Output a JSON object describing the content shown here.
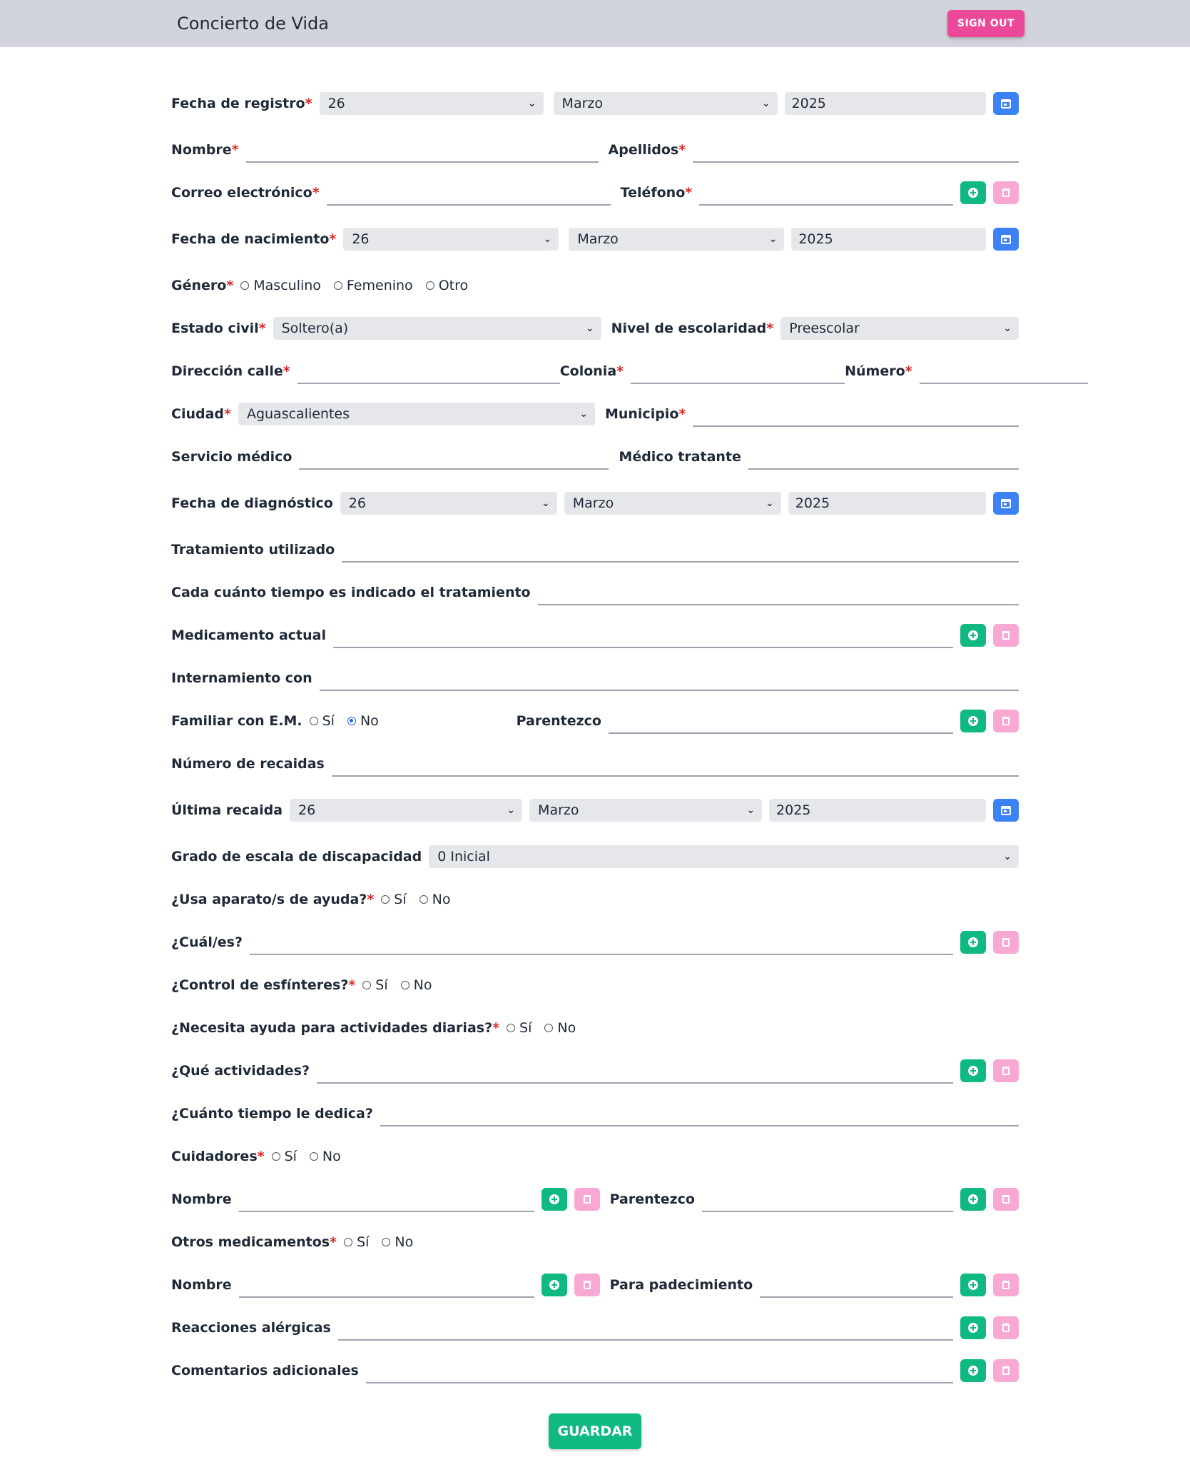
{
  "header": {
    "title": "Concierto de Vida",
    "sign_out": "SIGN OUT"
  },
  "req": "*",
  "fecha_registro": {
    "label": "Fecha de registro",
    "day": "26",
    "month": "Marzo",
    "year": "2025"
  },
  "nombre": {
    "label": "Nombre"
  },
  "apellidos": {
    "label": "Apellidos"
  },
  "correo": {
    "label": "Correo electrónico"
  },
  "telefono": {
    "label": "Teléfono"
  },
  "fecha_nacimiento": {
    "label": "Fecha de nacimiento",
    "day": "26",
    "month": "Marzo",
    "year": "2025"
  },
  "genero": {
    "label": "Género",
    "options": [
      "Masculino",
      "Femenino",
      "Otro"
    ]
  },
  "estado_civil": {
    "label": "Estado civil",
    "value": "Soltero(a)"
  },
  "escolaridad": {
    "label": "Nivel de escolaridad",
    "value": "Preescolar"
  },
  "direccion": {
    "label": "Dirección calle"
  },
  "colonia": {
    "label": "Colonia"
  },
  "numero": {
    "label": "Número"
  },
  "ciudad": {
    "label": "Ciudad",
    "value": "Aguascalientes"
  },
  "municipio": {
    "label": "Municipio"
  },
  "servicio_medico": {
    "label": "Servicio médico"
  },
  "medico_tratante": {
    "label": "Médico tratante"
  },
  "fecha_diagnostico": {
    "label": "Fecha de diagnóstico",
    "day": "26",
    "month": "Marzo",
    "year": "2025"
  },
  "tratamiento": {
    "label": "Tratamiento utilizado"
  },
  "frecuencia": {
    "label": "Cada cuánto tiempo es indicado el tratamiento"
  },
  "medicamento_actual": {
    "label": "Medicamento actual"
  },
  "internamiento": {
    "label": "Internamiento con"
  },
  "familiar_em": {
    "label": "Familiar con E.M.",
    "yes": "Sí",
    "no": "No",
    "selected": "No"
  },
  "parentezco1": {
    "label": "Parentezco"
  },
  "recaidas": {
    "label": "Número de recaidas"
  },
  "ultima_recaida": {
    "label": "Última recaida",
    "day": "26",
    "month": "Marzo",
    "year": "2025"
  },
  "grado_escala": {
    "label": "Grado de escala de discapacidad",
    "value": "0 Inicial"
  },
  "usa_aparato": {
    "label": "¿Usa aparato/s de ayuda?",
    "yes": "Sí",
    "no": "No"
  },
  "cuales": {
    "label": "¿Cuál/es?"
  },
  "control": {
    "label": "¿Control de esfínteres?",
    "yes": "Sí",
    "no": "No"
  },
  "necesita_ayuda": {
    "label": "¿Necesita ayuda para actividades diarias?",
    "yes": "Sí",
    "no": "No"
  },
  "que_actividades": {
    "label": "¿Qué actividades?"
  },
  "cuanto_tiempo": {
    "label": "¿Cuánto tiempo le dedica?"
  },
  "cuidadores": {
    "label": "Cuidadores",
    "yes": "Sí",
    "no": "No"
  },
  "cuidador_nombre": {
    "label": "Nombre"
  },
  "cuidador_parentezco": {
    "label": "Parentezco"
  },
  "otros_medicamentos": {
    "label": "Otros medicamentos",
    "yes": "Sí",
    "no": "No"
  },
  "med_nombre": {
    "label": "Nombre"
  },
  "padecimiento": {
    "label": "Para padecimiento"
  },
  "reacciones": {
    "label": "Reacciones alérgicas"
  },
  "comentarios": {
    "label": "Comentarios adicionales"
  },
  "save": "GUARDAR",
  "colors": {
    "header_bg": "#d1d5db",
    "signout": "#ec4899",
    "add": "#10b981",
    "delete": "#f9a8d4",
    "calendar": "#3b82f6",
    "required": "#dc2626"
  }
}
